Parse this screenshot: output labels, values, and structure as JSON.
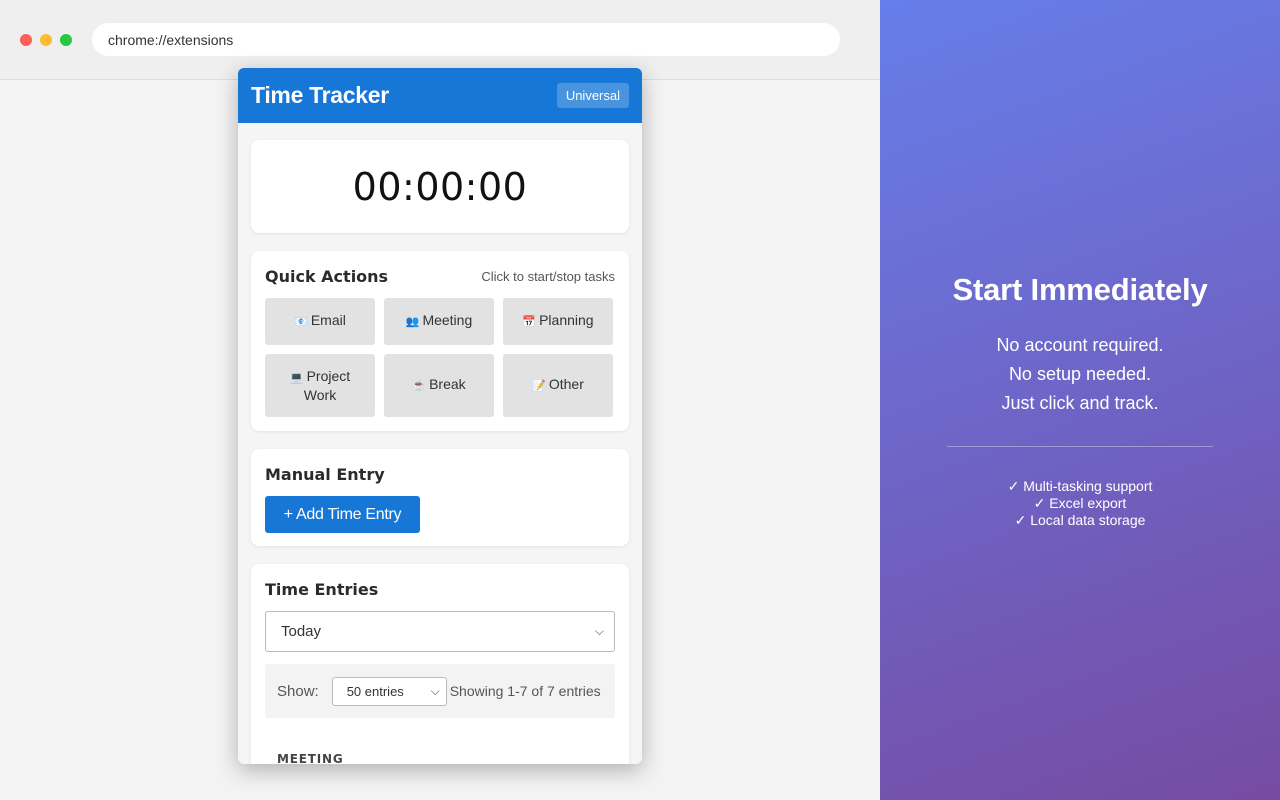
{
  "browser": {
    "address": "chrome://extensions"
  },
  "popup": {
    "title": "Time Tracker",
    "badge": "Universal",
    "timer": "00:00:00",
    "quick_actions": {
      "title": "Quick Actions",
      "hint": "Click to start/stop tasks",
      "buttons": [
        {
          "icon": "📧",
          "label": "Email"
        },
        {
          "icon": "👥",
          "label": "Meeting"
        },
        {
          "icon": "📅",
          "label": "Planning"
        },
        {
          "icon": "💻",
          "label": "Project Work"
        },
        {
          "icon": "☕",
          "label": "Break"
        },
        {
          "icon": "📝",
          "label": "Other"
        }
      ]
    },
    "manual_entry": {
      "title": "Manual Entry",
      "button": "+ Add Time Entry"
    },
    "time_entries": {
      "title": "Time Entries",
      "filter_selected": "Today",
      "show_label": "Show:",
      "page_size_selected": "50 entries",
      "showing_text": "Showing 1-7 of 7 entries",
      "first_group": "MEETING"
    }
  },
  "promo": {
    "title": "Start Immediately",
    "lines": [
      "No account required.",
      "No setup needed.",
      "Just click and track."
    ],
    "features": [
      "✓ Multi-tasking support",
      "✓ Excel export",
      "✓ Local data storage"
    ],
    "gradient_start": "#667eea",
    "gradient_end": "#764ba2"
  },
  "colors": {
    "accent": "#1677d6"
  }
}
